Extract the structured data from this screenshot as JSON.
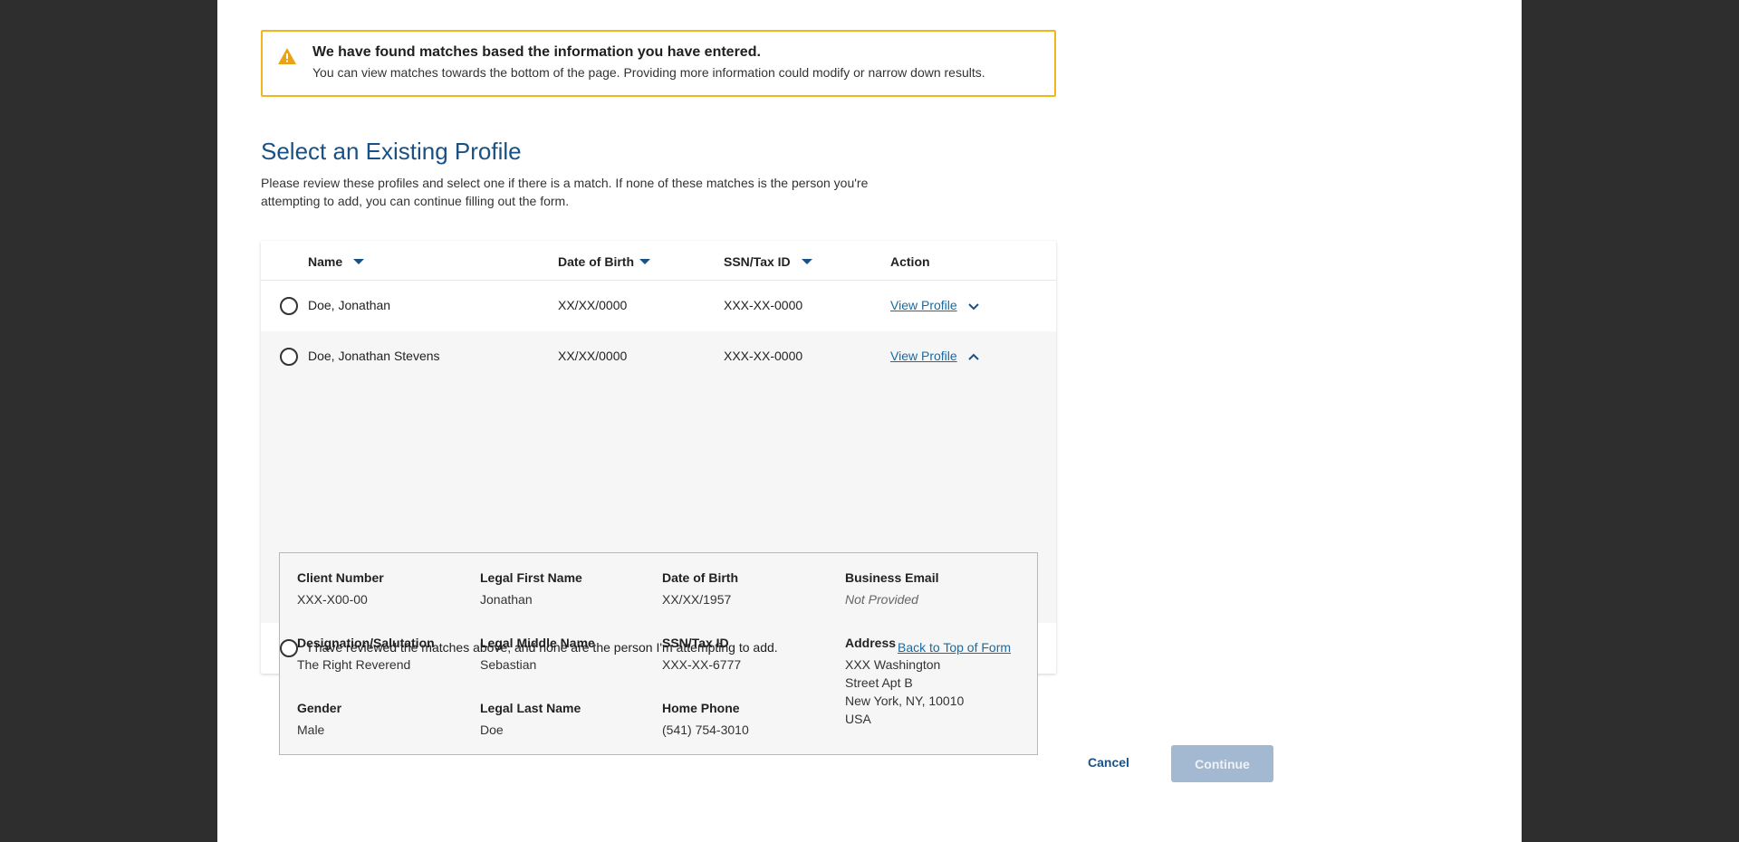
{
  "alert": {
    "title": "We have found matches based the information you have entered.",
    "body": "You can view matches towards the bottom of the page. Providing more information could modify or narrow down results."
  },
  "section": {
    "title": "Select an Existing Profile",
    "description": "Please review these profiles and select one if there is a match. If none of these matches is the person you're attempting to add, you can continue filling out the form."
  },
  "table": {
    "headers": {
      "name": "Name",
      "dob": "Date of Birth",
      "ssn": "SSN/Tax ID",
      "action": "Action"
    },
    "rows": [
      {
        "name": "Doe, Jonathan",
        "dob": "XX/XX/0000",
        "ssn": "XXX-XX-0000",
        "action": "View Profile",
        "expanded": false
      },
      {
        "name": "Doe, Jonathan Stevens",
        "dob": "XX/XX/0000",
        "ssn": "XXX-XX-0000",
        "action": "View Profile",
        "expanded": true
      }
    ],
    "details": {
      "client_number_label": "Client Number",
      "client_number": "XXX-X00-00",
      "designation_label": "Designation/Salutation",
      "designation": "The Right Reverend",
      "gender_label": "Gender",
      "gender": "Male",
      "first_name_label": "Legal First Name",
      "first_name": "Jonathan",
      "middle_name_label": "Legal Middle Name",
      "middle_name": "Sebastian",
      "last_name_label": "Legal Last Name",
      "last_name": "Doe",
      "dob_label": "Date of Birth",
      "dob": "XX/XX/1957",
      "ssn_label": "SSN/Tax ID",
      "ssn": "XXX-XX-6777",
      "home_phone_label": "Home Phone",
      "home_phone": "(541) 754-3010",
      "business_email_label": "Business Email",
      "business_email": "Not Provided",
      "address_label": "Address",
      "address_line1": "XXX Washington",
      "address_line2": "Street Apt B",
      "address_line3": "New York, NY, 10010",
      "address_line4": "USA"
    },
    "none_option": "I have reviewed the matches above, and none are the person I'm attempting to add.",
    "back_to_top": "Back to Top of Form"
  },
  "footer": {
    "cancel": "Cancel",
    "continue": "Continue"
  },
  "colors": {
    "accent": "#1a5185",
    "link": "#1a6aa3",
    "warning": "#f2b61c",
    "disabled_button": "#a3b9d1"
  }
}
